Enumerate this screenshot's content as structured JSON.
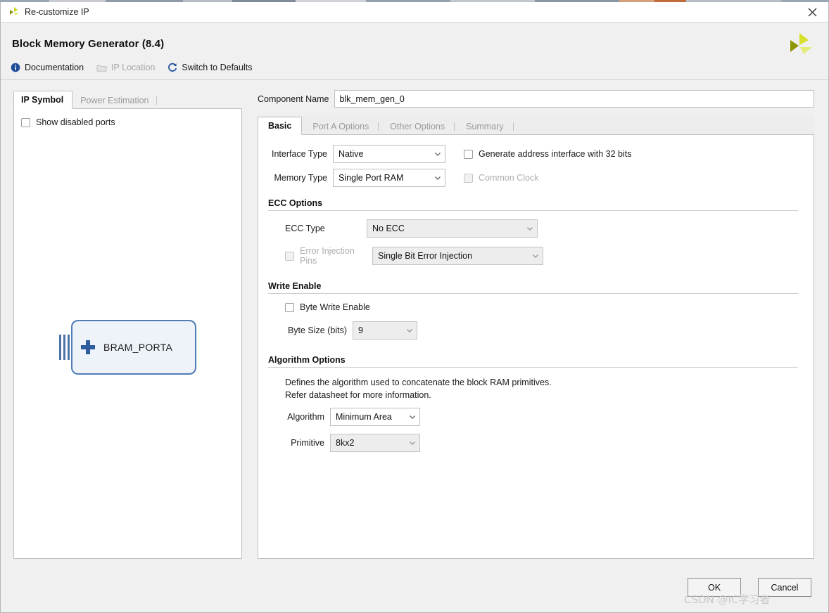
{
  "window": {
    "title": "Re-customize IP",
    "close_icon": "close-icon",
    "app_icon": "xilinx-logo-icon"
  },
  "header": {
    "title": "Block Memory Generator (8.4)",
    "logo_icon": "xilinx-pinwheel-logo"
  },
  "toolbar": {
    "documentation": "Documentation",
    "ip_location": "IP Location",
    "switch_to_defaults": "Switch to Defaults",
    "documentation_icon": "info-icon",
    "ip_location_icon": "folder-icon",
    "switch_icon": "refresh-icon"
  },
  "left_panel": {
    "tabs": [
      {
        "label": "IP Symbol",
        "active": true
      },
      {
        "label": "Power Estimation",
        "active": false
      }
    ],
    "show_disabled_ports": {
      "label": "Show disabled ports",
      "checked": false
    },
    "symbol": {
      "name": "BRAM_PORTA",
      "expander_icon": "plus-icon",
      "port_icon": "port-bars-icon"
    }
  },
  "main": {
    "component_name": {
      "label": "Component Name",
      "value": "blk_mem_gen_0"
    },
    "tabs": [
      {
        "label": "Basic",
        "active": true
      },
      {
        "label": "Port A Options",
        "active": false
      },
      {
        "label": "Other Options",
        "active": false
      },
      {
        "label": "Summary",
        "active": false
      }
    ],
    "interface_type": {
      "label": "Interface Type",
      "value": "Native",
      "enabled": true
    },
    "memory_type": {
      "label": "Memory Type",
      "value": "Single Port RAM",
      "enabled": true
    },
    "generate_address_interface": {
      "label": "Generate address interface with 32 bits",
      "checked": false,
      "enabled": true
    },
    "common_clock": {
      "label": "Common Clock",
      "checked": false,
      "enabled": false
    },
    "ecc_options": {
      "title": "ECC Options",
      "ecc_type": {
        "label": "ECC Type",
        "value": "No ECC",
        "enabled": false
      },
      "error_injection_pins": {
        "label": "Error Injection Pins",
        "checked": false,
        "enabled": false,
        "value": "Single Bit Error Injection"
      }
    },
    "write_enable": {
      "title": "Write Enable",
      "byte_write_enable": {
        "label": "Byte Write Enable",
        "checked": false,
        "enabled": true
      },
      "byte_size": {
        "label": "Byte Size (bits)",
        "value": "9",
        "enabled": false
      }
    },
    "algorithm_options": {
      "title": "Algorithm Options",
      "description_line1": "Defines the algorithm used to concatenate the block RAM primitives.",
      "description_line2": "Refer datasheet for more information.",
      "algorithm": {
        "label": "Algorithm",
        "value": "Minimum Area",
        "enabled": true
      },
      "primitive": {
        "label": "Primitive",
        "value": "8kx2",
        "enabled": false
      }
    }
  },
  "footer": {
    "ok": "OK",
    "cancel": "Cancel"
  },
  "watermark": {
    "text": "CSDN @IC学习者"
  }
}
